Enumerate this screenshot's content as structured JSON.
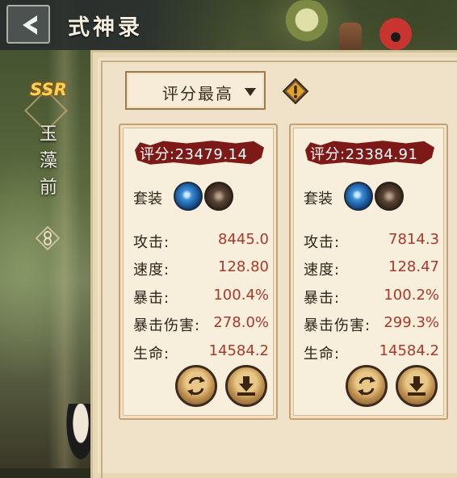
{
  "header": {
    "title": "式神录"
  },
  "sidebar": {
    "rarity": "SSR",
    "shikigami_name": "玉藻前"
  },
  "sort": {
    "selected": "评分最高"
  },
  "cards": [
    {
      "score": "评分:23479.14",
      "set_label": "套装",
      "stats": [
        {
          "label": "攻击:",
          "value": "8445.0"
        },
        {
          "label": "速度:",
          "value": "128.80"
        },
        {
          "label": "暴击:",
          "value": "100.4%"
        },
        {
          "label": "暴击伤害:",
          "value": "278.0%"
        },
        {
          "label": "生命:",
          "value": "14584.2"
        }
      ]
    },
    {
      "score": "评分:23384.91",
      "set_label": "套装",
      "stats": [
        {
          "label": "攻击:",
          "value": "7814.3"
        },
        {
          "label": "速度:",
          "value": "128.47"
        },
        {
          "label": "暴击:",
          "value": "100.2%"
        },
        {
          "label": "暴击伤害:",
          "value": "299.3%"
        },
        {
          "label": "生命:",
          "value": "14584.2"
        }
      ]
    }
  ],
  "colors": {
    "score_banner": "#7d1a17",
    "stat_value": "#a8392b",
    "panel_bg": "#efe2c8"
  },
  "icons": [
    "back-arrow-icon",
    "exclamation-icon",
    "rotate-icon",
    "equip-download-icon",
    "set-orb-icon"
  ]
}
